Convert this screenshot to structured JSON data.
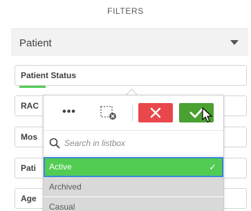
{
  "header": {
    "title": "FILTERS"
  },
  "section": {
    "label": "Patient"
  },
  "filters": [
    {
      "label": "Patient Status"
    },
    {
      "label": "RAC"
    },
    {
      "label": "Mos"
    },
    {
      "label": "Pati"
    },
    {
      "label": "Age"
    }
  ],
  "popover": {
    "toolbar": {
      "more_label": "•••",
      "icons": [
        "more-icon",
        "clear-selection-icon",
        "cancel-x-icon",
        "confirm-check-icon"
      ],
      "cancel_color": "#e8484c",
      "confirm_color": "#4aa030"
    },
    "search": {
      "placeholder": "Search in listbox",
      "value": ""
    },
    "items": [
      {
        "label": "Active",
        "state": "selected"
      },
      {
        "label": "Archived",
        "state": "alternative"
      },
      {
        "label": "Casual",
        "state": "alternative"
      }
    ]
  },
  "colors": {
    "selected": "#52cc52",
    "alternative": "#d9d9d9",
    "focus_border": "#3a87d6"
  }
}
